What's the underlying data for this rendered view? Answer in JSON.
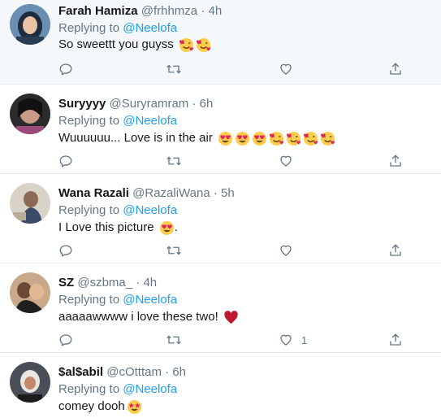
{
  "replies": [
    {
      "name": "Farah Hamiza",
      "handle": "@frhhmza",
      "sep": "·",
      "time": "4h",
      "replying_prefix": "Replying to ",
      "replying_to": "@Neelofa",
      "text": "So sweettt you guyss",
      "emojis": [
        "smiling-face-with-hearts",
        "smiling-face-with-hearts"
      ],
      "like_count": ""
    },
    {
      "name": "Suryyyy",
      "handle": "@Suryramram",
      "sep": "·",
      "time": "6h",
      "replying_prefix": "Replying to ",
      "replying_to": "@Neelofa",
      "text": "Wuuuuuu... Love is in the air",
      "emojis": [
        "heart-eyes",
        "heart-eyes",
        "heart-eyes",
        "smiling-face-with-hearts",
        "smiling-face-with-hearts",
        "smiling-face-with-hearts",
        "smiling-face-with-hearts"
      ],
      "like_count": ""
    },
    {
      "name": "Wana Razali",
      "handle": "@RazaliWana",
      "sep": "·",
      "time": "5h",
      "replying_prefix": "Replying to ",
      "replying_to": "@Neelofa",
      "text": "I Love this picture",
      "emojis": [
        "heart-eyes"
      ],
      "trailing": ".",
      "like_count": ""
    },
    {
      "name": "SZ",
      "handle": "@szbma_",
      "sep": "·",
      "time": "4h",
      "replying_prefix": "Replying to ",
      "replying_to": "@Neelofa",
      "text": "aaaaawwww i love these two!",
      "emojis": [
        "red-heart"
      ],
      "like_count": "1"
    },
    {
      "name": "$al$abil",
      "handle": "@cOtttam",
      "sep": "·",
      "time": "6h",
      "replying_prefix": "Replying to ",
      "replying_to": "@Neelofa",
      "text": "comey dooh",
      "emojis": [
        "star-struck"
      ],
      "like_count": ""
    }
  ],
  "icons": {
    "reply": "reply-icon",
    "retweet": "retweet-icon",
    "like": "like-icon",
    "share": "share-icon"
  },
  "colors": {
    "accent": "#1da1f2",
    "muted": "#657786",
    "text": "#14171a",
    "heart": "#e0245e"
  }
}
